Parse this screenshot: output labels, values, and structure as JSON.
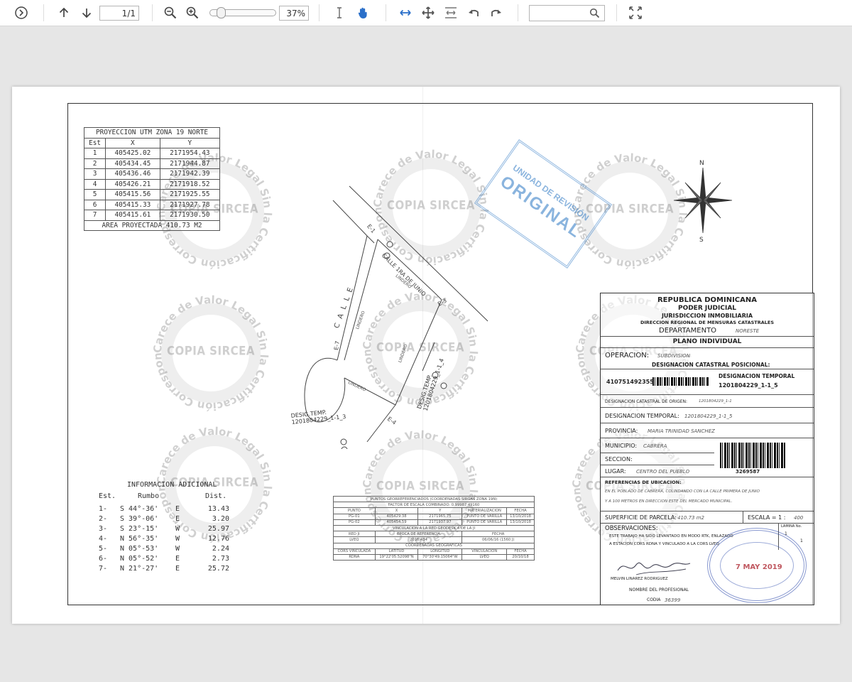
{
  "toolbar": {
    "page_current": "1",
    "page_total": "/1",
    "zoom_percent": "37%",
    "zoom_level": 0.37,
    "search_placeholder": "",
    "icons": [
      "sidebar-toggle-icon",
      "arrow-up-icon",
      "arrow-down-icon",
      "zoom-out-icon",
      "zoom-in-icon",
      "text-cursor-icon",
      "hand-icon",
      "fit-width-icon",
      "move-icon",
      "fit-page-icon",
      "undo-icon",
      "redo-icon",
      "search-icon",
      "fullscreen-icon"
    ],
    "accent": "#2a6fc9"
  },
  "document": {
    "utm_table": {
      "title": "PROYECCION UTM ZONA 19 NORTE",
      "headers": [
        "Est",
        "X",
        "Y"
      ],
      "rows": [
        [
          "1",
          "405425.02",
          "2171954.43"
        ],
        [
          "2",
          "405434.45",
          "2171944.87"
        ],
        [
          "3",
          "405436.46",
          "2171942.39"
        ],
        [
          "4",
          "405426.21",
          "2171918.52"
        ],
        [
          "5",
          "405415.56",
          "2171925.55"
        ],
        [
          "6",
          "405415.33",
          "2171927.78"
        ],
        [
          "7",
          "405415.61",
          "2171930.50"
        ]
      ],
      "area": "AREA PROYECTADA 410.73 M2"
    },
    "info": {
      "title": "INFORMACION ADICIONAL",
      "headers": [
        "Est.",
        "Rumbo",
        "Dist."
      ],
      "rows": [
        [
          "1-",
          "S 44°-36'",
          "E",
          "13.43"
        ],
        [
          "2-",
          "S 39°-06'",
          "E",
          "3.20"
        ],
        [
          "3-",
          "S 23°-15'",
          "W",
          "25.97"
        ],
        [
          "4-",
          "N 56°-35'",
          "W",
          "12.76"
        ],
        [
          "5-",
          "N 05°-53'",
          "W",
          "2.24"
        ],
        [
          "6-",
          "N 05°-52'",
          "E",
          "2.73"
        ],
        [
          "7-",
          "N 21°-27'",
          "E",
          "25.72"
        ]
      ]
    },
    "map_labels": {
      "street": "CALLE 1RA DE JUNIO",
      "calle": "C A L L E",
      "lindero": "LINDERO",
      "desig_temp_left_1": "DESIG.TEMP.",
      "desig_temp_left_2": "1201804229_1-1_3",
      "desig_temp_right_1": "DESIG.TEMP.",
      "desig_temp_right_2": "1201804229_1-1_4",
      "e4": "E-4",
      "e3": "E-3",
      "e7": "E-7",
      "e1": "E-1"
    },
    "watermark": {
      "ring_text": "Carece de Valor Legal Sin la Certificación Correspondiente",
      "center_text": "COPIA SIRCEA"
    },
    "stamp": {
      "line1": "UNIDAD DE REVISIÓN",
      "line2": "ORIGINAL"
    },
    "compass": {
      "n": "N",
      "s": "S"
    },
    "coords_table": {
      "title": "PUNTOS GEORREFERENCIADOS (COORDENADAS SIRGAS ZONA 19N)",
      "factor": "FACTOR DE ESCALA COMBINADO: 0.99987 49160",
      "headers": [
        "PUNTO",
        "X",
        "Y",
        "MATERIALIZACION",
        "FECHA"
      ],
      "rows": [
        [
          "PG-01",
          "405429.38",
          "2171965.75",
          "PUNTO DE VARILLA",
          "13/10/2018"
        ],
        [
          "PG-02",
          "405454.59",
          "2171937.97",
          "PUNTO DE VARILLA",
          "13/10/2018"
        ]
      ],
      "vinculacion": "VINCULACION A LA RED GEODESICA DE LA JI",
      "vinc_headers": [
        "RED JI",
        "EPOCA DE REFERENCIA",
        "FECHA"
      ],
      "vinc_row": [
        "LVEQ",
        "2016.434",
        "06/06/16 (1560 J)"
      ],
      "geo_title": "COORDENADAS GEOGRAFICAS",
      "geo_headers": [
        "CORS VINCULADA",
        "LATITUD",
        "LONGITUD",
        "VINCULACION",
        "FECHA"
      ],
      "geo_row": [
        "RDNA",
        "19°22'05.52098\"N",
        "70°30'49.15064\"W",
        "LVEQ",
        "20/10/18"
      ]
    },
    "title_block": {
      "republica": "REPUBLICA DOMINICANA",
      "poder": "PODER JUDICIAL",
      "jurisdiccion": "JURISDICCION INMOBILIARIA",
      "direccion": "DIRECCION REGIONAL DE MENSURAS CATASTRALES",
      "departamento_label": "DEPARTAMENTO",
      "departamento_value": "NORESTE",
      "plano": "PLANO INDIVIDUAL",
      "operacion_label": "OPERACION:",
      "operacion_value": "SUBDIVISION",
      "designacion_catastral_header": "DESIGNACION CATASTRAL POSICIONAL:",
      "parcel_number": "410751492355",
      "designacion_temporal_header": "DESIGNACION TEMPORAL",
      "designacion_temporal_value": "1201804229_1-1_5",
      "origen_label": "DESIGNACION CATASTRAL DE ORIGEN:",
      "origen_value": "1201804229_1-1",
      "temporal_label": "DESIGNACION TEMPORAL:",
      "temporal_value": "1201804229_1-1_5",
      "provincia_label": "PROVINCIA:",
      "provincia_value": "MARIA TRINIDAD SANCHEZ",
      "municipio_label": "MUNICIPIO:",
      "municipio_value": "CABRERA",
      "seccion_label": "SECCION:",
      "lugar_label": "LUGAR:",
      "lugar_value": "CENTRO DEL PUEBLO",
      "barcode_number": "3269587",
      "referencias_label": "REFERENCIAS DE UBICACION:",
      "referencias_1": "EN EL POBLADO DE CABRERA, COLINDANDO CON LA CALLE PRIMERA DE JUNIO",
      "referencias_2": "Y A 100 METROS EN DIRECCION ESTE DEL MERCADO MUNICIPAL.",
      "superficie_label": "SUPERFICIE DE PARCELA:",
      "superficie_value": "410.73 m2",
      "escala_label": "ESCALA = 1 :",
      "escala_value": "400",
      "lamina_label": "LAMINA No.",
      "lamina_value": "1",
      "lamina_of": "1",
      "observaciones_label": "OBSERVACIONES:",
      "observaciones_1": "ESTE TRABAJO HA SIDO LEVANTADO EN MODO RTK, ENLAZADO",
      "observaciones_2": "A ESTACION CORS RDNA Y VINCULADO A LA CORS LVEQ",
      "firma_nombre": "MELVIN LINAREZ RODRIGUEZ",
      "nombre_label": "NOMBRE DEL PROFESIONAL",
      "codia_label": "CODIA",
      "codia_value": "36399",
      "seal_date": "7 MAY 2019"
    }
  }
}
